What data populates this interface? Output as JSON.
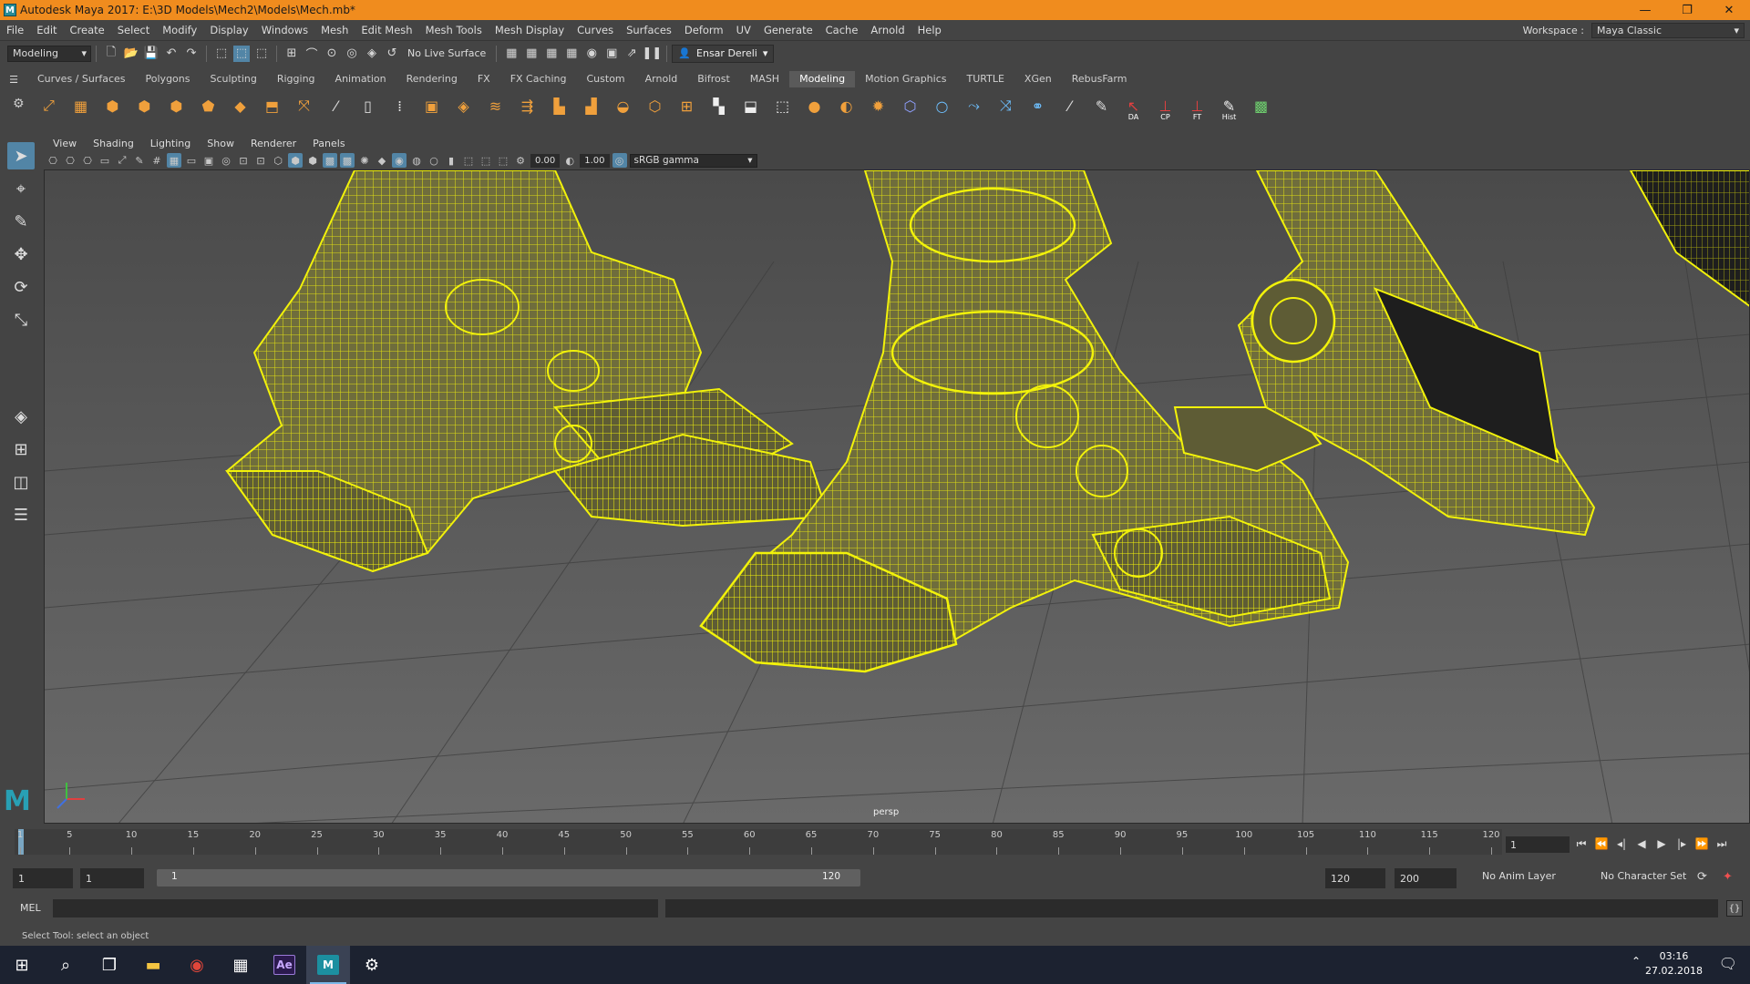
{
  "window": {
    "title": "Autodesk Maya 2017: E:\\3D Models\\Mech2\\Models\\Mech.mb*"
  },
  "menus": [
    "File",
    "Edit",
    "Create",
    "Select",
    "Modify",
    "Display",
    "Windows",
    "Mesh",
    "Edit Mesh",
    "Mesh Tools",
    "Mesh Display",
    "Curves",
    "Surfaces",
    "Deform",
    "UV",
    "Generate",
    "Cache",
    "Arnold",
    "Help"
  ],
  "workspace": {
    "label": "Workspace :",
    "value": "Maya Classic"
  },
  "statusline": {
    "menuset": "Modeling",
    "live_surface": "No Live Surface",
    "user": "Ensar Dereli"
  },
  "shelf": {
    "tabs": [
      "Curves / Surfaces",
      "Polygons",
      "Sculpting",
      "Rigging",
      "Animation",
      "Rendering",
      "FX",
      "FX Caching",
      "Custom",
      "Arnold",
      "Bifrost",
      "MASH",
      "Modeling",
      "Motion Graphics",
      "TURTLE",
      "XGen",
      "RebusFarm"
    ],
    "active_tab": "Modeling",
    "labels": {
      "da": "DA",
      "cp": "CP",
      "ft": "FT",
      "hist": "Hist"
    }
  },
  "panel": {
    "menus": [
      "View",
      "Shading",
      "Lighting",
      "Show",
      "Renderer",
      "Panels"
    ],
    "exposure": "0.00",
    "gamma": "1.00",
    "color_space": "sRGB gamma",
    "camera": "persp"
  },
  "timeline": {
    "ticks": [
      1,
      5,
      10,
      15,
      20,
      25,
      30,
      35,
      40,
      45,
      50,
      55,
      60,
      65,
      70,
      75,
      80,
      85,
      90,
      95,
      100,
      105,
      110,
      115,
      120
    ],
    "current_frame": "1",
    "max_frame": 120
  },
  "range": {
    "start": "1",
    "start_inner": "1",
    "slider_start": "1",
    "slider_end": "120",
    "end_inner": "120",
    "end": "200",
    "anim_layer": "No Anim Layer",
    "character_set": "No Character Set"
  },
  "cmdline": {
    "language": "MEL"
  },
  "helpline": {
    "text": "Select Tool: select an object"
  },
  "taskbar": {
    "time": "03:16",
    "date": "27.02.2018",
    "ae_label": "Ae",
    "maya_label": "M"
  }
}
